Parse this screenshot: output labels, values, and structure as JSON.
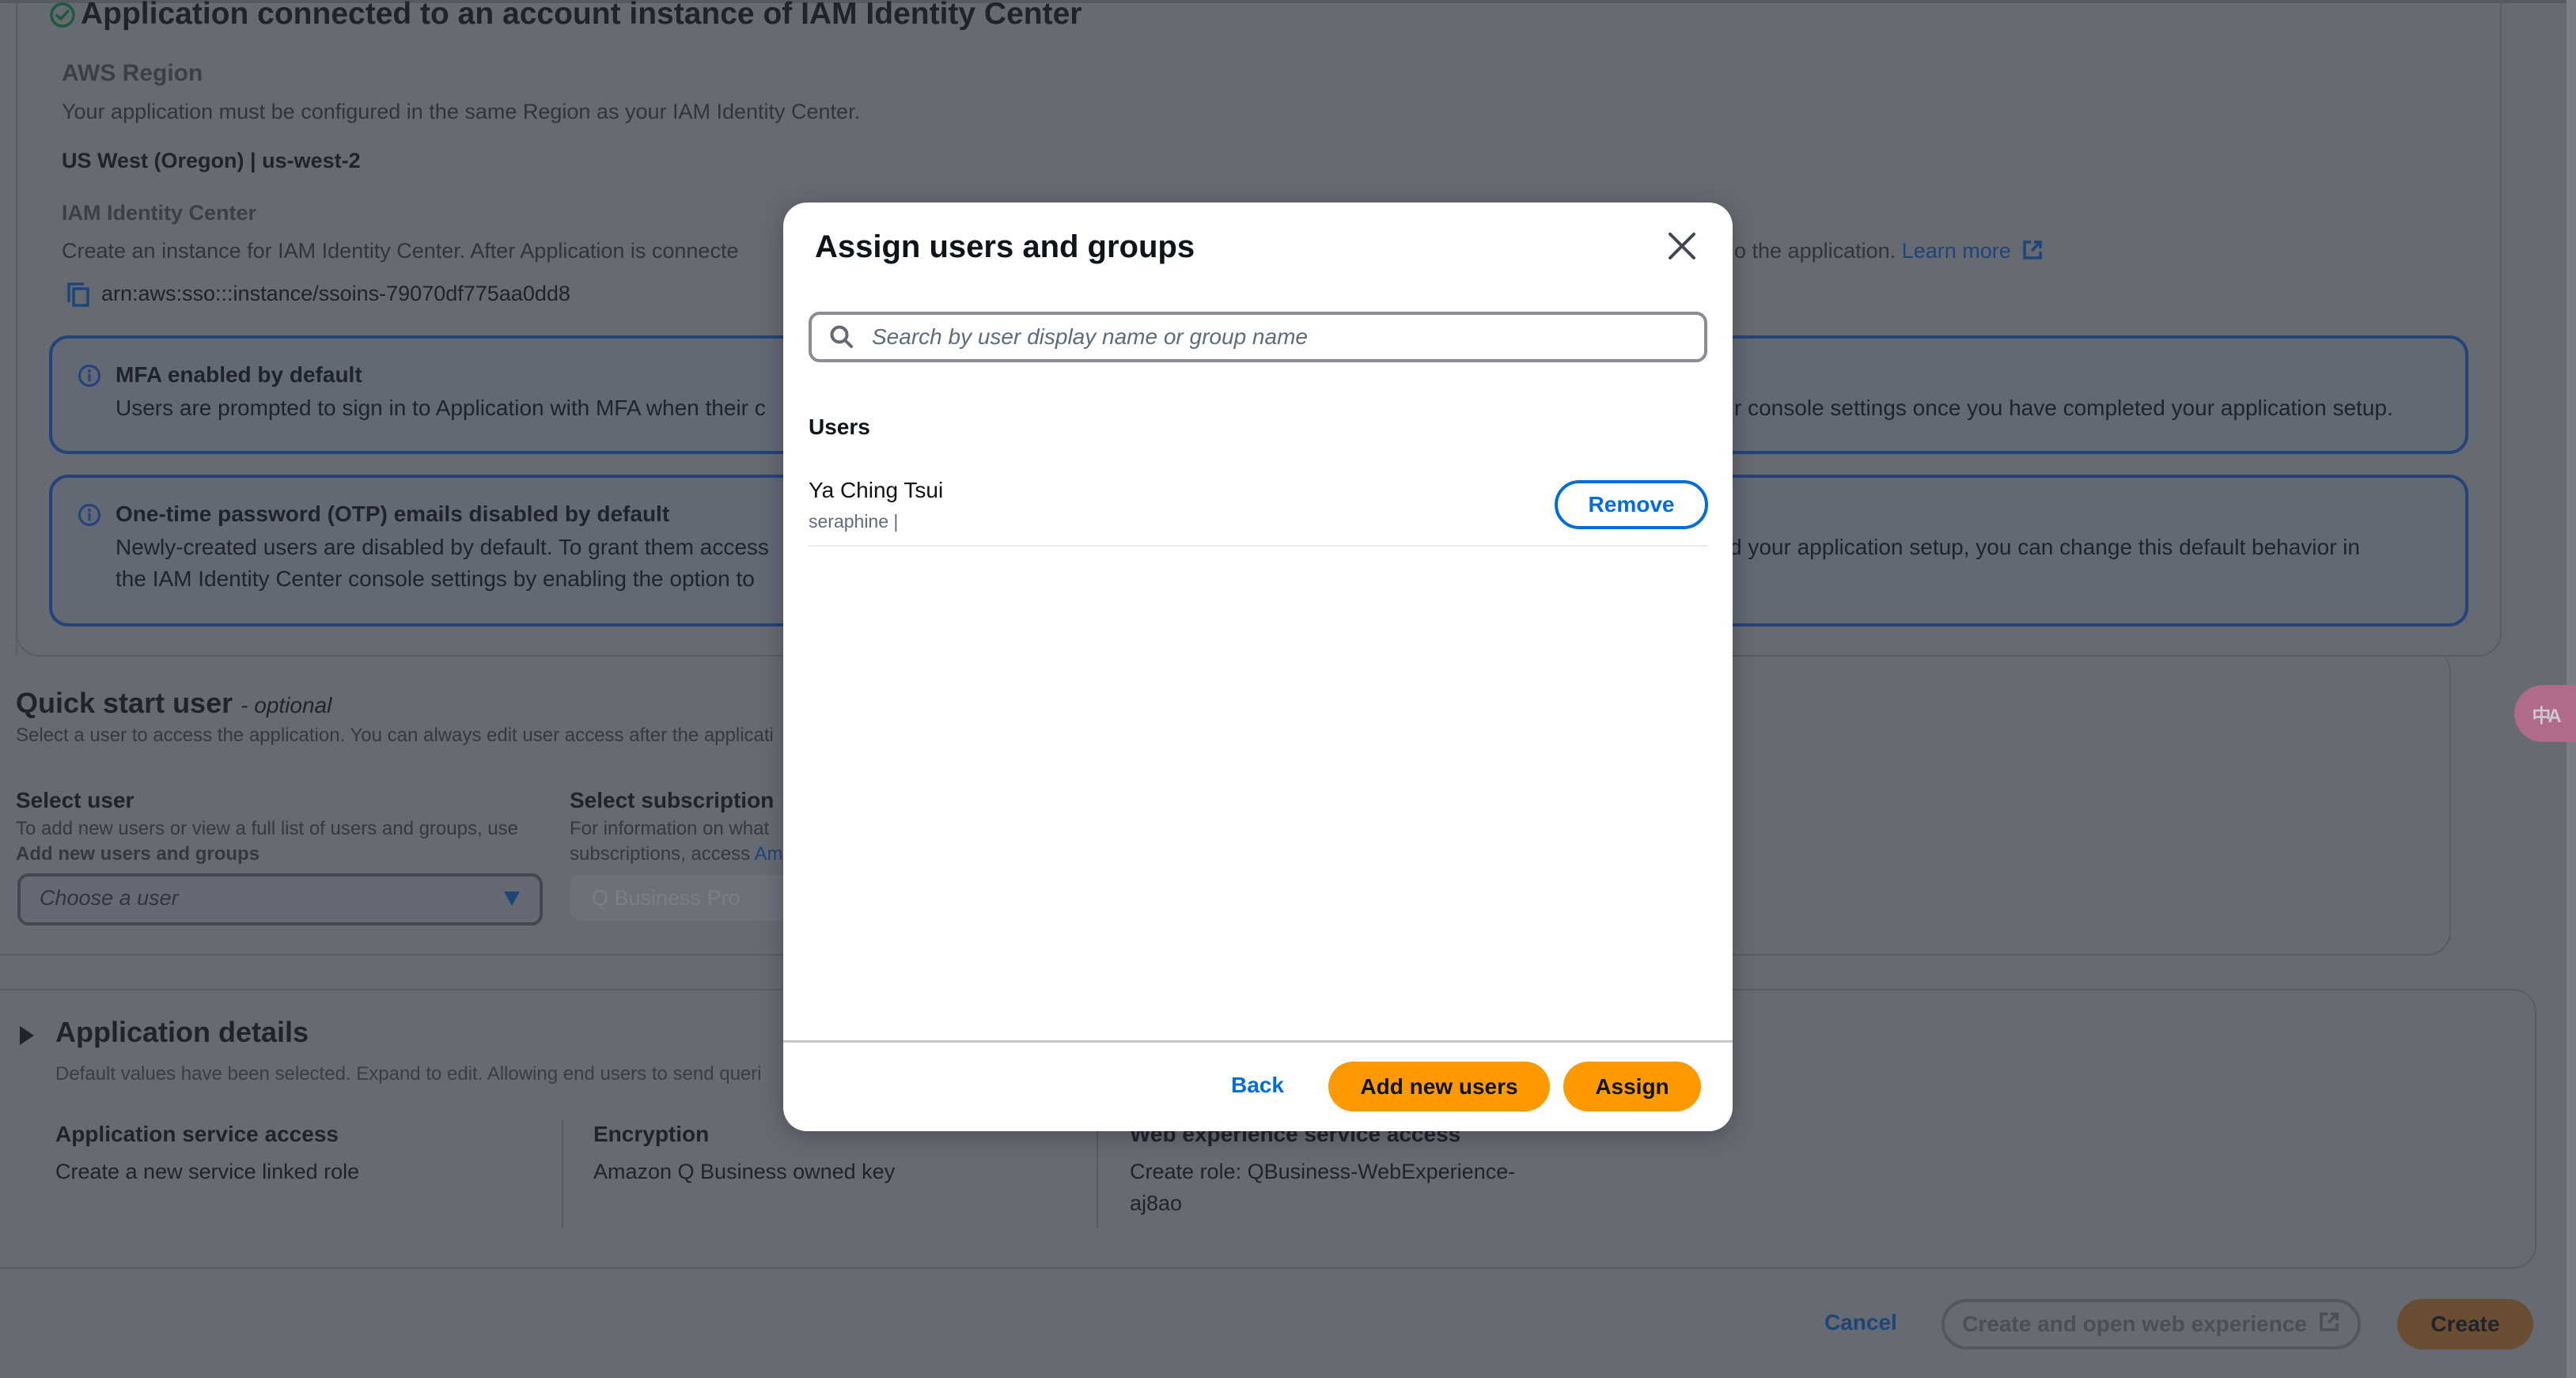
{
  "background": {
    "connected_heading": "Application connected to an account instance of IAM Identity Center",
    "aws_region": {
      "label": "AWS Region",
      "description": "Your application must be configured in the same Region as your IAM Identity Center.",
      "value": "US West (Oregon) | us-west-2"
    },
    "iam_identity_center": {
      "label": "IAM Identity Center",
      "description_left": "Create an instance for IAM Identity Center. After Application is connecte",
      "description_right": "o the application.",
      "learn_more": "Learn more",
      "arn": "arn:aws:sso:::instance/ssoins-79070df775aa0dd8"
    },
    "mfa_alert": {
      "title": "MFA enabled by default",
      "text_left": "Users are prompted to sign in to Application with MFA when their c",
      "text_right": "r console settings once you have completed your application setup."
    },
    "otp_alert": {
      "title": "One-time password (OTP) emails disabled by default",
      "line1_left": "Newly-created users are disabled by default. To grant them access",
      "line1_right": "d your application setup, you can change this default behavior in",
      "line2_left": "the IAM Identity Center console settings by enabling the option to"
    },
    "quick_start": {
      "title": "Quick start user",
      "optional": "- optional",
      "description": "Select a user to access the application. You can always edit user access after the applicati",
      "select_user": {
        "label": "Select user",
        "help": "To add new users or view a full list of users and groups, use",
        "link": "Add new users and groups",
        "placeholder": "Choose a user"
      },
      "select_subscription": {
        "label": "Select subscription",
        "help_line1": "For information on what",
        "help_line2": "subscriptions, access ",
        "help_link": "Am",
        "value": "Q Business Pro"
      }
    },
    "application_details": {
      "title": "Application details",
      "description": "Default values have been selected. Expand to edit. Allowing end users to send queri",
      "columns": [
        {
          "label": "Application service access",
          "value": "Create a new service linked role"
        },
        {
          "label": "Encryption",
          "value": "Amazon Q Business owned key"
        },
        {
          "label": "Web experience service access",
          "value_line1": "Create role: QBusiness-WebExperience-",
          "value_line2": "aj8ao"
        }
      ]
    },
    "footer": {
      "cancel": "Cancel",
      "create_and_open": "Create and open web experience",
      "create": "Create"
    },
    "translate_button": "中A"
  },
  "modal": {
    "title": "Assign users and groups",
    "search": {
      "placeholder": "Search by user display name or group name",
      "value": ""
    },
    "users_heading": "Users",
    "users": [
      {
        "display_name": "Ya Ching Tsui",
        "username": "seraphine |",
        "action": "Remove"
      }
    ],
    "footer": {
      "back": "Back",
      "add_new_users": "Add new users",
      "assign": "Assign"
    }
  },
  "colors": {
    "primary_orange": "#ff9900",
    "link_blue": "#006ce0",
    "success_green": "#1c5a3a",
    "info_blue": "#23437a"
  }
}
